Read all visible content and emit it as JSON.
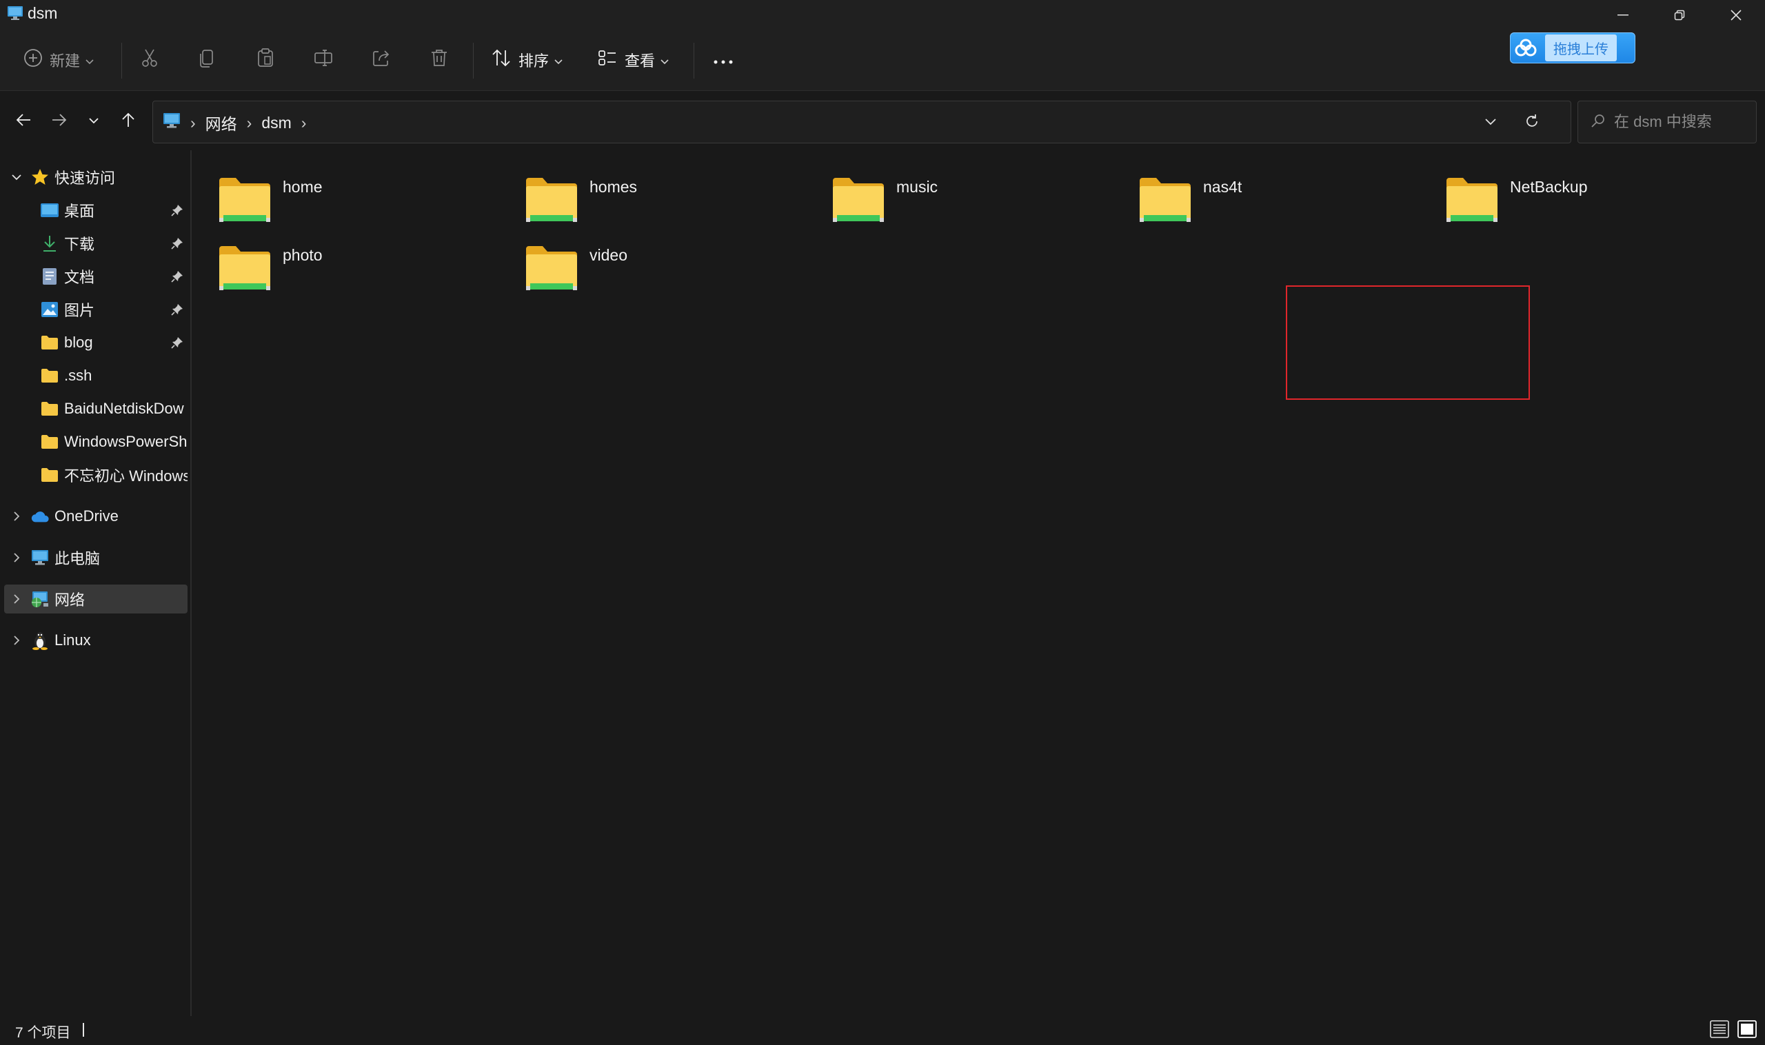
{
  "window": {
    "title": "dsm",
    "icon": "monitor-icon",
    "controls": [
      "minimize-icon",
      "restore-icon",
      "close-icon"
    ]
  },
  "upload_widget": {
    "icon": "baidu-cloud-icon",
    "label": "拖拽上传"
  },
  "toolbar": {
    "new_label": "新建",
    "sort_label": "排序",
    "view_label": "查看",
    "icons": [
      "cut-icon",
      "copy-icon",
      "paste-icon",
      "rename-icon",
      "share-icon",
      "delete-icon",
      "more-icon"
    ]
  },
  "address": {
    "crumbs": [
      "网络",
      "dsm"
    ],
    "search_placeholder": "在 dsm 中搜索"
  },
  "sidebar": {
    "quick_access": {
      "label": "快速访问",
      "items": [
        {
          "label": "桌面",
          "icon": "desktop-icon",
          "pinned": true
        },
        {
          "label": "下载",
          "icon": "download-icon",
          "pinned": true
        },
        {
          "label": "文档",
          "icon": "document-icon",
          "pinned": true
        },
        {
          "label": "图片",
          "icon": "pictures-icon",
          "pinned": true
        },
        {
          "label": "blog",
          "icon": "folder-icon",
          "pinned": true
        },
        {
          "label": ".ssh",
          "icon": "folder-icon",
          "pinned": false
        },
        {
          "label": "BaiduNetdiskDow",
          "icon": "folder-icon",
          "pinned": false
        },
        {
          "label": "WindowsPowerSh",
          "icon": "folder-icon",
          "pinned": false
        },
        {
          "label": "不忘初心 Windows",
          "icon": "folder-icon",
          "pinned": false
        }
      ]
    },
    "roots": [
      {
        "label": "OneDrive",
        "icon": "onedrive-icon"
      },
      {
        "label": "此电脑",
        "icon": "this-pc-icon"
      },
      {
        "label": "网络",
        "icon": "network-icon",
        "selected": true
      },
      {
        "label": "Linux",
        "icon": "linux-icon"
      }
    ]
  },
  "content": {
    "folders": [
      "home",
      "homes",
      "music",
      "nas4t",
      "NetBackup",
      "photo",
      "video"
    ],
    "highlighted": "nas4t",
    "highlight_color": "#e0262b"
  },
  "status": {
    "item_count": "7 个项目"
  },
  "colors": {
    "background": "#191919",
    "chrome": "#202020",
    "folder_yellow": "#f6c744",
    "share_green": "#3fc75a",
    "selected_row": "#383838"
  }
}
